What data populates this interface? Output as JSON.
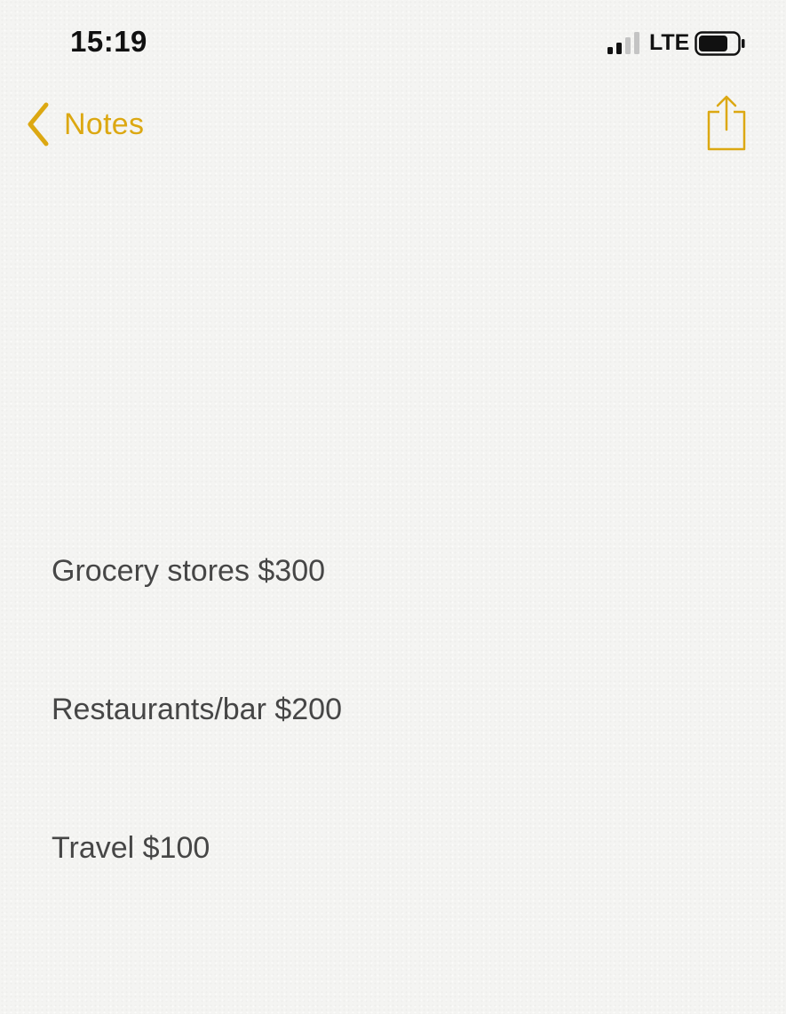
{
  "status_bar": {
    "time": "15:19",
    "carrier": "LTE",
    "signal_icon": "signal-bars-icon",
    "battery_icon": "battery-icon"
  },
  "nav": {
    "back_label": "Notes",
    "back_icon": "chevron-left-icon",
    "share_icon": "share-icon",
    "accent_color": "#dca812"
  },
  "note": {
    "lines": [
      {
        "text": "Grocery stores $300"
      },
      {
        "text": "Restaurants/bar $200"
      },
      {
        "text": "Travel $100"
      }
    ]
  }
}
